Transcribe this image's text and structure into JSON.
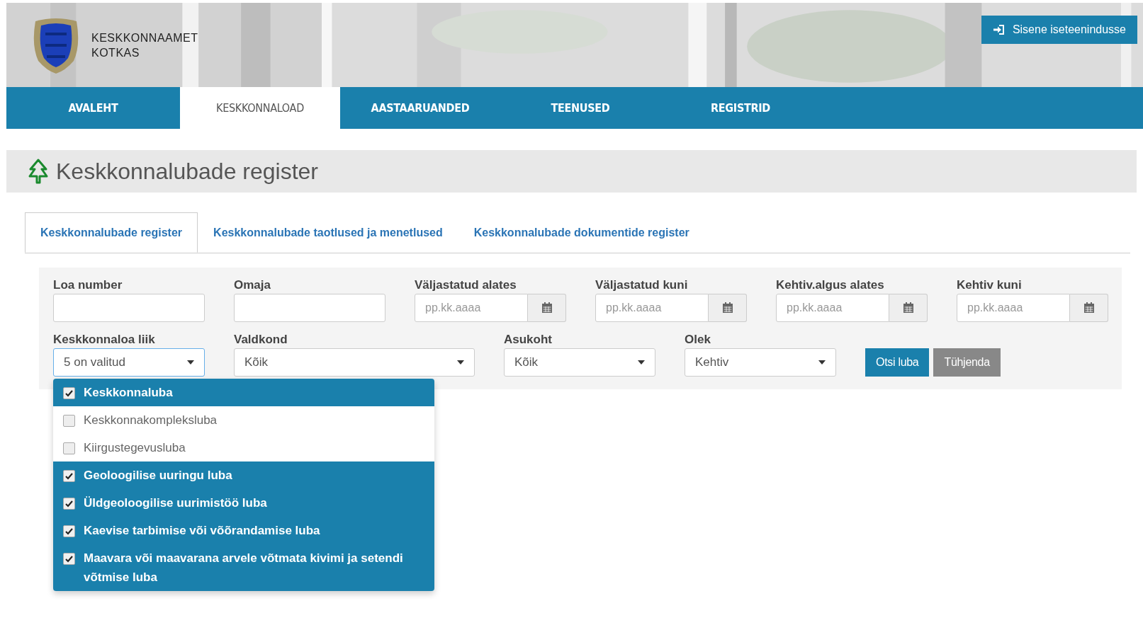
{
  "header": {
    "logo_line1": "KESKKONNAAMET",
    "logo_line2": "KOTKAS",
    "login_button": "Sisene iseteenindusse"
  },
  "nav": [
    {
      "label": "AVALEHT",
      "selected": false
    },
    {
      "label": "KESKKONNALOAD",
      "selected": true
    },
    {
      "label": "AASTAARUANDED",
      "selected": false
    },
    {
      "label": "TEENUSED",
      "selected": false
    },
    {
      "label": "REGISTRID",
      "selected": false
    }
  ],
  "page_title": "Keskkonnalubade register",
  "tabs": [
    {
      "label": "Keskkonnalubade register",
      "selected": true
    },
    {
      "label": "Keskkonnalubade taotlused ja menetlused",
      "selected": false
    },
    {
      "label": "Keskkonnalubade dokumentide register",
      "selected": false
    }
  ],
  "filters_row1": [
    {
      "label": "Loa number",
      "kind": "text"
    },
    {
      "label": "Omaja",
      "kind": "text"
    },
    {
      "label": "Väljastatud alates",
      "kind": "date",
      "placeholder": "pp.kk.aaaa"
    },
    {
      "label": "Väljastatud kuni",
      "kind": "date",
      "placeholder": "pp.kk.aaaa"
    },
    {
      "label": "Kehtiv.algus alates",
      "kind": "date",
      "placeholder": "pp.kk.aaaa"
    },
    {
      "label": "Kehtiv kuni",
      "kind": "date",
      "placeholder": "pp.kk.aaaa"
    }
  ],
  "filters_row2": [
    {
      "label": "Keskkonnaloa liik",
      "value": "5 on valitud",
      "expanded": true
    },
    {
      "label": "Valdkond",
      "value": "Kõik",
      "expanded": false
    },
    {
      "label": "Asukoht",
      "value": "Kõik",
      "expanded": false
    },
    {
      "label": "Olek",
      "value": "Kehtiv",
      "expanded": false
    }
  ],
  "buttons": [
    {
      "label": "Otsi luba",
      "kind": "primary"
    },
    {
      "label": "Tühjenda",
      "kind": "secondary"
    }
  ],
  "dropdown_options": [
    {
      "label": "Keskkonnaluba",
      "checked": true
    },
    {
      "label": "Keskkonnakompleksluba",
      "checked": false
    },
    {
      "label": "Kiirgustegevusluba",
      "checked": false
    },
    {
      "label": "Geoloogilise uuringu luba",
      "checked": true
    },
    {
      "label": "Üldgeoloogilise uurimistöö luba",
      "checked": true
    },
    {
      "label": "Kaevise tarbimise või võõrandamise luba",
      "checked": true
    },
    {
      "label": "Maavara või maavarana arvele võtmata kivimi ja setendi võtmise luba",
      "checked": true
    }
  ]
}
